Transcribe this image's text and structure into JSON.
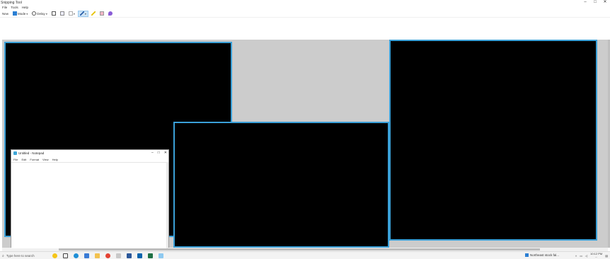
{
  "window": {
    "title": "Snipping Tool",
    "controls": {
      "minimize": "–",
      "maximize": "□",
      "close": "✕"
    }
  },
  "menubar": {
    "items": [
      "File",
      "Tools",
      "Help"
    ]
  },
  "toolbar": {
    "new_label": "New",
    "mode_label": "Mode",
    "delay_label": "Delay",
    "icons": [
      "save-icon",
      "copy-icon",
      "send-icon",
      "pen-icon",
      "highlighter-icon",
      "eraser-icon",
      "paint3d-icon"
    ],
    "active_color": "#cce4f7"
  },
  "notepad": {
    "title": "Untitled - Notepad",
    "menu": [
      "File",
      "Edit",
      "Format",
      "View",
      "Help"
    ],
    "controls": {
      "minimize": "–",
      "maximize": "□",
      "close": "✕"
    }
  },
  "canvas": {
    "background": "#cccccc",
    "window_border": "#3aa0d8"
  },
  "taskbar": {
    "search_placeholder": "Type here to search",
    "weather_text": "Northeast stock fal...",
    "clock_time": "10:12 PM",
    "clock_date": "..."
  }
}
